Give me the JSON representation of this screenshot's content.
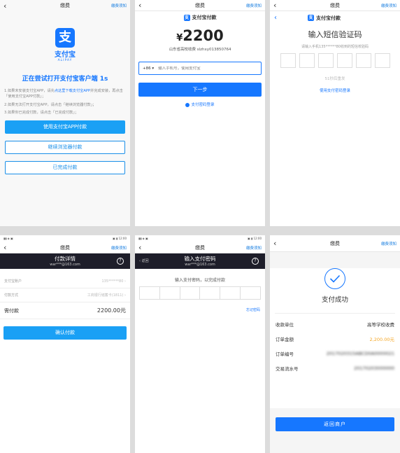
{
  "common": {
    "title": "缴费",
    "notice": "缴费须知",
    "back": "‹"
  },
  "p1": {
    "logo_char": "支",
    "logo_name": "支付宝",
    "logo_en": "ALIPAY",
    "trying": "正在尝试打开支付宝客户端 1s",
    "tip1_a": "1.如果未安装支付宝APP，请先",
    "tip1_link": "点这里下载支付宝APP",
    "tip1_b": "并完成安装，再点击「使用支付宝APP付款」；",
    "tip2": "2.如果无法打开支付宝APP，请点击「继续浏览器付款」；",
    "tip3": "3.如果你已完成付款，请点击「已完成付款」；",
    "btn_app": "使用支付宝APP付款",
    "btn_browser": "继续浏览器付款",
    "btn_done": "已完成付款"
  },
  "p2": {
    "brand": "支付宝付款",
    "yen": "¥",
    "amount": "2200",
    "merchant": "山东省高校收费 slzhxy013850764",
    "cc": "+86 ▾",
    "phone_placeholder": "输入手机号，使用支付宝",
    "next": "下一步",
    "pwd_login": "支付密码登录"
  },
  "p3": {
    "brand": "支付宝付款",
    "title": "输入短信验证码",
    "sub": "请输入手机135******80收到的短信校验码",
    "resend": "51秒后重发",
    "pwd_pay": "使用支付密码登录"
  },
  "p4": {
    "status_left": "▮▮ ◈ ▣",
    "status_right": "▣ ▮ 12:00",
    "head_title": "付款详情",
    "account": "war***@163.com",
    "help": "?",
    "rows": [
      {
        "k": "支付宝账户",
        "v": "135******80 ›"
      },
      {
        "k": "付款方式",
        "v": "工商银行储蓄卡(1811) ›"
      }
    ],
    "need_label": "需付款",
    "need_value": "2200.00元",
    "confirm": "确认付款"
  },
  "p5": {
    "status_left": "▮▮ ◈ ▣",
    "status_right": "▣ ▮ 12:00",
    "dback": "‹ 返回",
    "head_title": "输入支付密码",
    "account": "war***@163.com",
    "help": "?",
    "hint": "输入支付密码，以完成付款",
    "forgot": "忘记密码"
  },
  "p6": {
    "success": "支付成功",
    "rows": [
      {
        "k": "收款单位",
        "v": "高等学校收费"
      },
      {
        "k": "订单金额",
        "v": "2,200.00元"
      },
      {
        "k": "订单编号",
        "v": "2017020315ABCD0A0000021"
      },
      {
        "k": "交易流水号",
        "v": "20170203000000"
      }
    ],
    "return": "返回商户"
  }
}
